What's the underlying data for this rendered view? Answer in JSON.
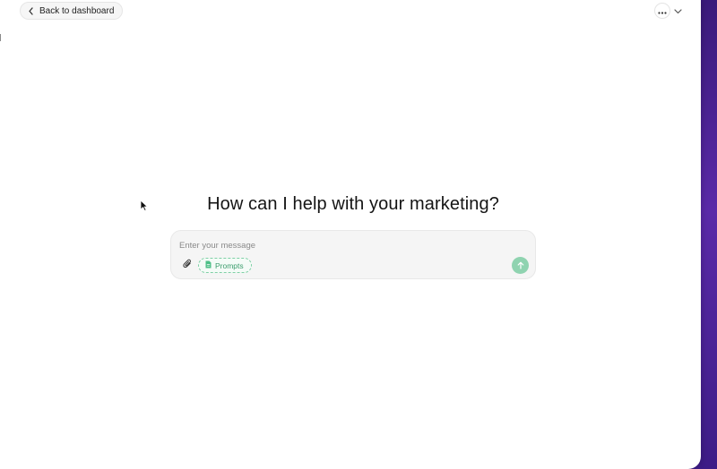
{
  "header": {
    "back_label": "Back to dashboard",
    "back_icon": "chevron-left-icon",
    "menu_icon": "more-horizontal-icon",
    "chevron_icon": "chevron-down-icon"
  },
  "main": {
    "headline": "How can I help with your marketing?"
  },
  "composer": {
    "placeholder": "Enter your message",
    "value": "",
    "attach_icon": "paperclip-icon",
    "prompts_label": "Prompts",
    "prompts_icon": "document-icon",
    "send_icon": "arrow-up-icon"
  },
  "colors": {
    "accent": "#3a9d6c",
    "send_button": "#8fd3b0",
    "background_gradient": "#4a2396"
  }
}
